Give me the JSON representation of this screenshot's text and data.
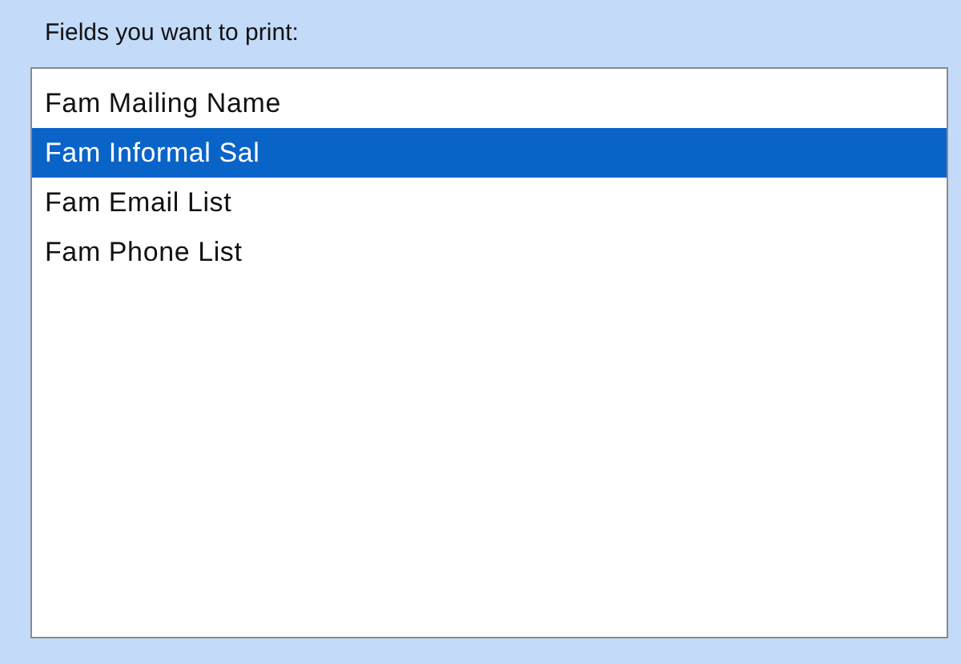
{
  "label": "Fields you want to print:",
  "list": [
    {
      "text": "Fam Mailing Name",
      "selected": false
    },
    {
      "text": "Fam Informal Sal",
      "selected": true
    },
    {
      "text": "Fam Email List",
      "selected": false
    },
    {
      "text": "Fam Phone List",
      "selected": false
    }
  ]
}
